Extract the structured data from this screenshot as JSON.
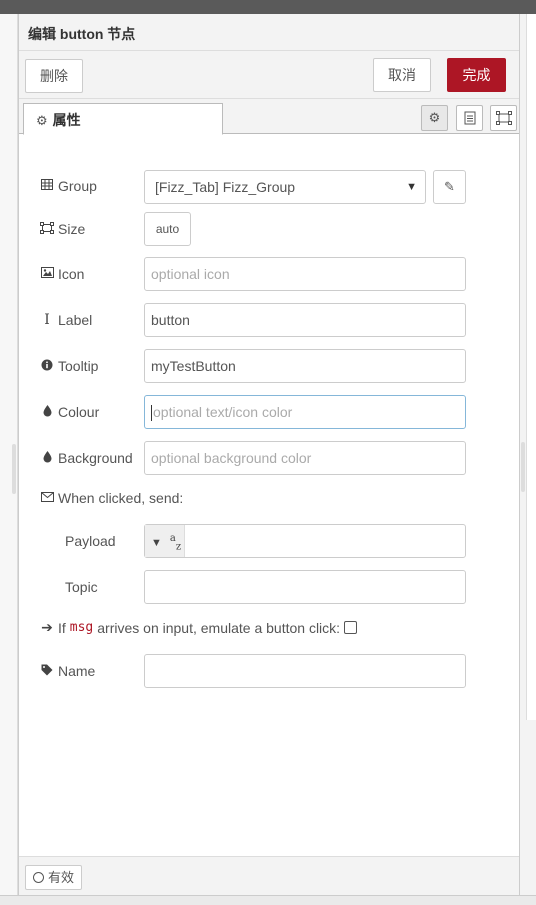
{
  "tray": {
    "title": "编辑 button 节点",
    "delete_label": "删除",
    "cancel_label": "取消",
    "done_label": "完成",
    "tab_properties": "属性",
    "status_label": "有效"
  },
  "form": {
    "group": {
      "label": "Group",
      "value": "[Fizz_Tab] Fizz_Group"
    },
    "size": {
      "label": "Size",
      "value": "auto"
    },
    "icon": {
      "label": "Icon",
      "placeholder": "optional icon"
    },
    "label_field": {
      "label": "Label",
      "value": "button"
    },
    "tooltip": {
      "label": "Tooltip",
      "value": "myTestButton"
    },
    "colour": {
      "label": "Colour",
      "placeholder": "optional text/icon color"
    },
    "background": {
      "label": "Background",
      "placeholder": "optional background color"
    },
    "when_clicked": "When clicked, send:",
    "payload": {
      "label": "Payload",
      "type_symbol": "a",
      "type_sub": "z"
    },
    "topic": {
      "label": "Topic"
    },
    "emulate": {
      "prefix": "If",
      "code": "msg",
      "suffix": "arrives on input, emulate a button click:"
    },
    "name": {
      "label": "Name"
    }
  },
  "colors": {
    "accent": "#ad1625",
    "focus_border": "#85b7d9"
  }
}
